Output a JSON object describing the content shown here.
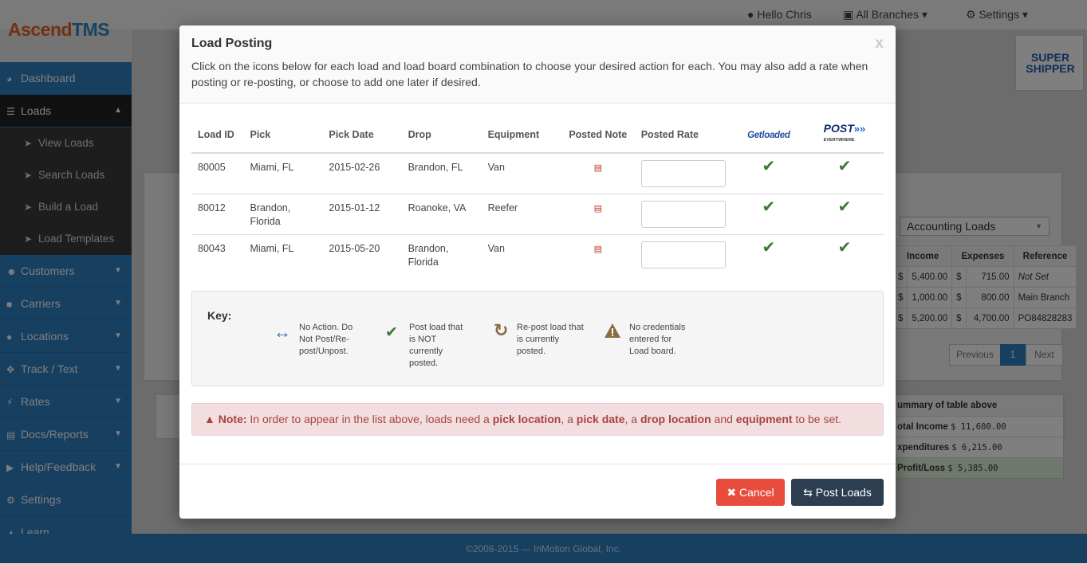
{
  "app": {
    "logo_part1": "Ascend",
    "logo_part2": "TMS",
    "hello": "Hello Chris",
    "branches": "All Branches",
    "settings": "Settings",
    "footer": "©2008-2015 — InMotion Global, Inc."
  },
  "sidebar": {
    "items": [
      {
        "label": "Dashboard"
      },
      {
        "label": "Loads"
      },
      {
        "label": "View Loads"
      },
      {
        "label": "Search Loads"
      },
      {
        "label": "Build a Load"
      },
      {
        "label": "Load Templates"
      },
      {
        "label": "Customers"
      },
      {
        "label": "Carriers"
      },
      {
        "label": "Locations"
      },
      {
        "label": "Track / Text"
      },
      {
        "label": "Rates"
      },
      {
        "label": "Docs/Reports"
      },
      {
        "label": "Help/Feedback"
      },
      {
        "label": "Settings"
      },
      {
        "label": "Learn"
      }
    ]
  },
  "background": {
    "view_select": "Accounting Loads",
    "columns": [
      "Income",
      "Expenses",
      "Reference"
    ],
    "rows": [
      [
        "$",
        "5,400.00",
        "$",
        "715.00",
        "Not Set"
      ],
      [
        "$",
        "1,000.00",
        "$",
        "800.00",
        "Main Branch"
      ],
      [
        "$",
        "5,200.00",
        "$",
        "4,700.00",
        "PO84828283"
      ]
    ],
    "pager": {
      "prev": "Previous",
      "page": "1",
      "next": "Next"
    },
    "summary": {
      "title": "ummary of table above",
      "income_label": "otal Income",
      "income": "$ 11,600.00",
      "exp_label": "xpenditures",
      "exp": "$ 6,215.00",
      "pl_label": "Profit/Loss",
      "pl": "$ 5,385.00"
    },
    "brand": "SUPER SHIPPER"
  },
  "modal": {
    "title": "Load Posting",
    "close": "x",
    "description": "Click on the icons below for each load and load board combination to choose your desired action for each. You may also add a rate when posting or re-posting, or choose to add one later if desired.",
    "columns": {
      "load_id": "Load ID",
      "pick": "Pick",
      "pick_date": "Pick Date",
      "drop": "Drop",
      "equipment": "Equipment",
      "posted_note": "Posted Note",
      "posted_rate": "Posted Rate"
    },
    "boards": {
      "getloaded": "Getloaded",
      "post": "POST",
      "post_sub": "EVERYWHERE"
    },
    "loads": [
      {
        "id": "80005",
        "pick": "Miami, FL",
        "pick_date": "2015-02-26",
        "drop": "Brandon, FL",
        "equipment": "Van",
        "rate": ""
      },
      {
        "id": "80012",
        "pick": "Brandon, Florida",
        "pick_date": "2015-01-12",
        "drop": "Roanoke, VA",
        "equipment": "Reefer",
        "rate": ""
      },
      {
        "id": "80043",
        "pick": "Miami, FL",
        "pick_date": "2015-05-20",
        "drop": "Brandon, Florida",
        "equipment": "Van",
        "rate": ""
      }
    ],
    "key": {
      "title": "Key:",
      "no_action": "No Action. Do Not Post/Re-post/Unpost.",
      "post": "Post load that is NOT currently posted.",
      "repost": "Re-post load that is currently posted.",
      "no_creds": "No credentials entered for Load board."
    },
    "note": {
      "label": "Note:",
      "t1": " In order to appear in the list above, loads need a ",
      "b1": "pick location",
      "t2": ", a ",
      "b2": "pick date",
      "t3": ", a ",
      "b3": "drop location",
      "t4": " and ",
      "b4": "equipment",
      "t5": " to be set."
    },
    "cancel": "Cancel",
    "post_loads": "Post Loads"
  }
}
